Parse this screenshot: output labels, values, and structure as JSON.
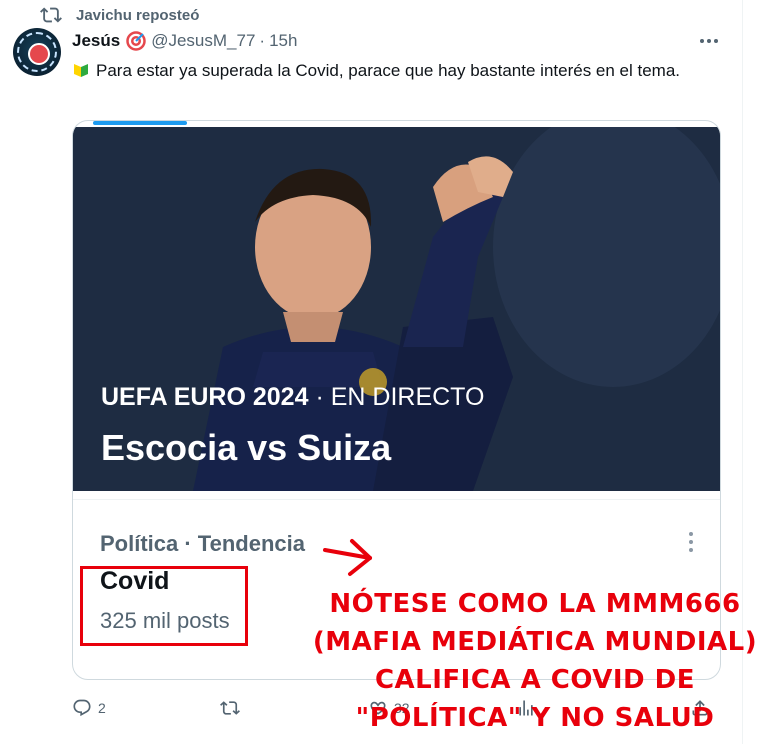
{
  "repost": {
    "icon": "repost-icon",
    "label": "Javichu reposteó"
  },
  "author": {
    "name": "Jesús",
    "badge_icon": "target-icon",
    "handle": "@JesusM_77",
    "separator": "·",
    "time": "15h"
  },
  "tweet": {
    "leaf_icon": "beginner-leaf-icon",
    "text": "Para estar ya superada la Covid, parace que hay bastante interés en el tema."
  },
  "card": {
    "eyebrow_event": "UEFA EURO 2024",
    "eyebrow_status": "· EN DIRECTO",
    "headline": "Escocia vs Suiza",
    "trend_meta": "Política · Tendencia",
    "trend_topic": "Covid",
    "trend_count": "325 mil posts"
  },
  "annotation": {
    "text_lines": [
      "NÓTESE COMO LA MMM666",
      "(MAFIA MEDIÁTICA MUNDIAL)",
      "CALIFICA A COVID DE",
      "\"POLÍTICA\" Y NO SALUD"
    ],
    "color": "#e8000b"
  },
  "actions": {
    "reply_count": "2",
    "repost_count": "",
    "like_count": "32"
  },
  "colors": {
    "accent": "#1d9bf0",
    "muted": "#536471",
    "text": "#0f1419"
  }
}
